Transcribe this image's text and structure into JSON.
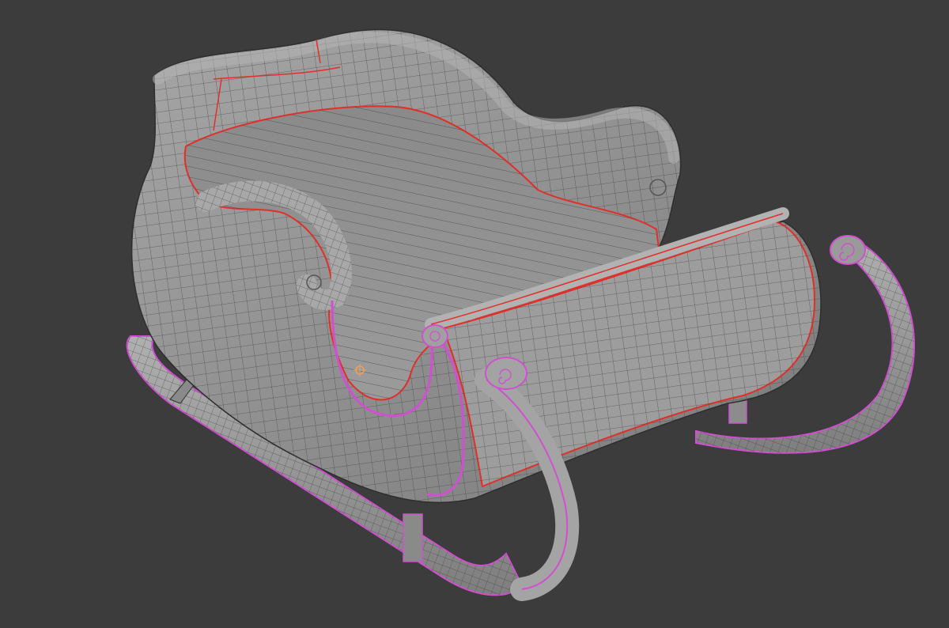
{
  "viewport": {
    "background_color": "#3c3c3c",
    "mesh_color": "#8f8f8f",
    "mesh_light_color": "#a9a9a9",
    "mesh_shadow_color": "#6d6d6d",
    "wire_color": "#2a2a2a",
    "seam_color": "#e0302a",
    "sharp_edge_color": "#d050d0",
    "object": "sleigh-mesh",
    "shading": "solid-wireframe-overlay",
    "origin_marker_icon": "object-origin-icon"
  }
}
